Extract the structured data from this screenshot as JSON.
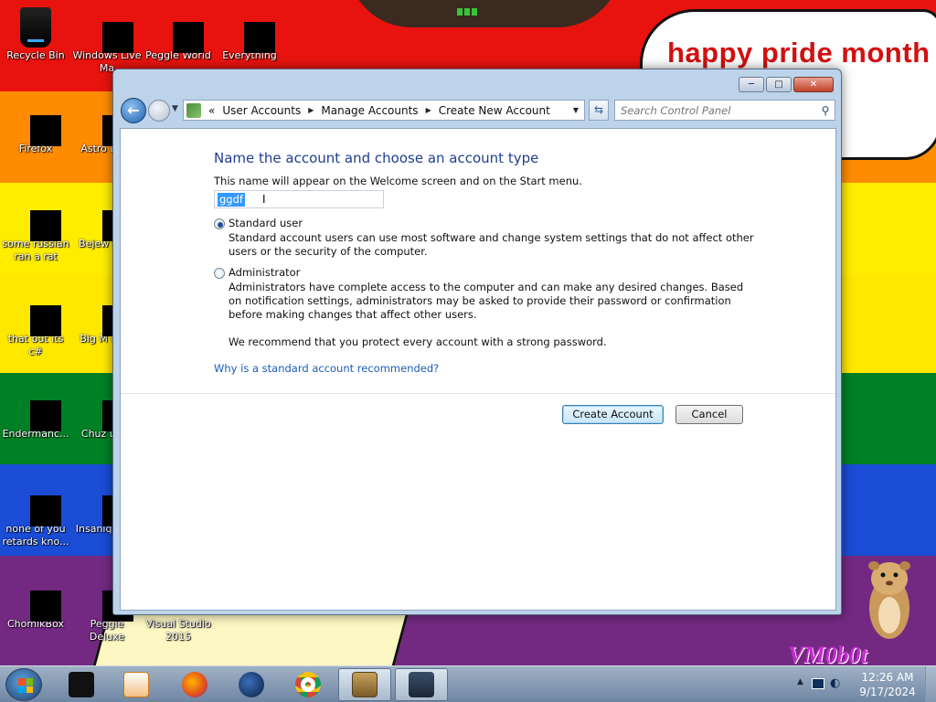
{
  "desktop": {
    "banner_text": "happy pride month",
    "watermark": "VM0b0t",
    "icons": [
      {
        "label": "Recycle Bin"
      },
      {
        "label": "Windows Live Ma"
      },
      {
        "label": "Peggle World"
      },
      {
        "label": "Everything"
      },
      {
        "label": "Firefox"
      },
      {
        "label": "Astro Delu"
      },
      {
        "label": "some russian ran a rat"
      },
      {
        "label": "Bejew Delu"
      },
      {
        "label": "that but its c#"
      },
      {
        "label": "Big M Delu"
      },
      {
        "label": "Endermanc..."
      },
      {
        "label": "Chuz Delu"
      },
      {
        "label": "none of you retards kno..."
      },
      {
        "label": "Insaniq Delu"
      },
      {
        "label": "ChomikBox"
      },
      {
        "label": "Peggle Deluxe"
      },
      {
        "label": "Visual Studio 2015"
      }
    ]
  },
  "window": {
    "caption": {
      "minimize": "─",
      "maximize": "□",
      "close": "✕"
    },
    "breadcrumb": {
      "overflow": "«",
      "items": [
        "User Accounts",
        "Manage Accounts",
        "Create New Account"
      ]
    },
    "search": {
      "placeholder": "Search Control Panel"
    },
    "heading": "Name the account and choose an account type",
    "name_description": "This name will appear on the Welcome screen and on the Start menu.",
    "name_value": "ggdf",
    "options": {
      "standard": {
        "label": "Standard user",
        "selected": true,
        "description": "Standard account users can use most software and change system settings that do not affect other users or the security of the computer."
      },
      "administrator": {
        "label": "Administrator",
        "selected": false,
        "description": "Administrators have complete access to the computer and can make any desired changes. Based on notification settings, administrators may be asked to provide their password or confirmation before making changes that affect other users."
      }
    },
    "recommendation": "We recommend that you protect every account with a strong password.",
    "why_link": "Why is a standard account recommended?",
    "buttons": {
      "create": "Create Account",
      "cancel": "Cancel"
    }
  },
  "taskbar": {
    "items": [
      {
        "icon": "black-app-icon"
      },
      {
        "icon": "media-player-icon"
      },
      {
        "icon": "firefox-icon"
      },
      {
        "icon": "globe-icon"
      },
      {
        "icon": "chrome-icon"
      },
      {
        "icon": "chomikbox-icon",
        "active": true
      },
      {
        "icon": "control-panel-icon",
        "active": true
      }
    ],
    "clock": {
      "time": "12:26 AM",
      "date": "9/17/2024"
    }
  },
  "colors": {
    "heading": "#1e3e8e",
    "link": "#1a5db8",
    "selection": "#3399ff",
    "banner": "#d21010"
  }
}
